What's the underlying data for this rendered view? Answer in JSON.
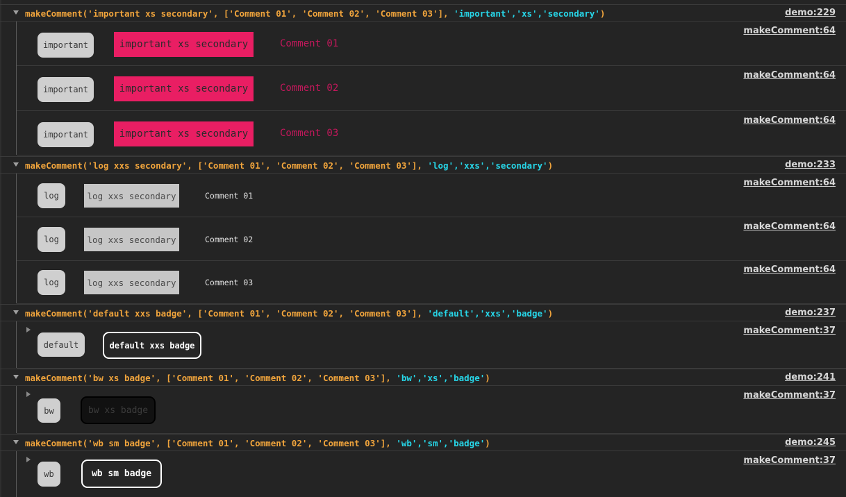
{
  "groups": [
    {
      "head_prefix": "makeComment('important xs secondary', ['Comment 01', 'Comment 02', 'Comment 03'], ",
      "head_args": "'important','xs','secondary'",
      "head_suffix": ")",
      "link": "demo:229",
      "rows": [
        {
          "label": "important",
          "styled": "important xs secondary",
          "comment": "Comment 01",
          "link": "makeComment:64"
        },
        {
          "label": "important",
          "styled": "important xs secondary",
          "comment": "Comment 02",
          "link": "makeComment:64"
        },
        {
          "label": "important",
          "styled": "important xs secondary",
          "comment": "Comment 03",
          "link": "makeComment:64"
        }
      ]
    },
    {
      "head_prefix": "makeComment('log xxs secondary', ['Comment 01', 'Comment 02', 'Comment 03'], ",
      "head_args": "'log','xxs','secondary'",
      "head_suffix": ")",
      "link": "demo:233",
      "rows": [
        {
          "label": "log",
          "styled": "log xxs secondary",
          "comment": "Comment 01",
          "link": "makeComment:64"
        },
        {
          "label": "log",
          "styled": "log xxs secondary",
          "comment": "Comment 02",
          "link": "makeComment:64"
        },
        {
          "label": "log",
          "styled": "log xxs secondary",
          "comment": "Comment 03",
          "link": "makeComment:64"
        }
      ]
    },
    {
      "head_prefix": "makeComment('default xxs badge', ['Comment 01', 'Comment 02', 'Comment 03'], ",
      "head_args": "'default','xxs','badge'",
      "head_suffix": ")",
      "link": "demo:237",
      "rows": [
        {
          "label": "default",
          "styled": "default xxs badge",
          "link": "makeComment:37"
        }
      ]
    },
    {
      "head_prefix": "makeComment('bw xs badge', ['Comment 01', 'Comment 02', 'Comment 03'], ",
      "head_args": "'bw','xs','badge'",
      "head_suffix": ")",
      "link": "demo:241",
      "rows": [
        {
          "label": "bw",
          "styled": "bw xs badge",
          "link": "makeComment:37"
        }
      ]
    },
    {
      "head_prefix": "makeComment('wb sm badge', ['Comment 01', 'Comment 02', 'Comment 03'], ",
      "head_args": "'wb','sm','badge'",
      "head_suffix": ")",
      "link": "demo:245",
      "rows": [
        {
          "label": "wb",
          "styled": "wb sm badge",
          "link": "makeComment:37"
        }
      ]
    }
  ],
  "colors": {
    "background": "#242424",
    "function_text": "#f0a43c",
    "args_text": "#27d6e8",
    "important": "#e91e63",
    "log_box": "#c6c6c6",
    "label_pill": "#cfcfcf"
  },
  "icons": {
    "group_toggle": "triangle-down-icon",
    "row_expand": "triangle-right-icon"
  }
}
